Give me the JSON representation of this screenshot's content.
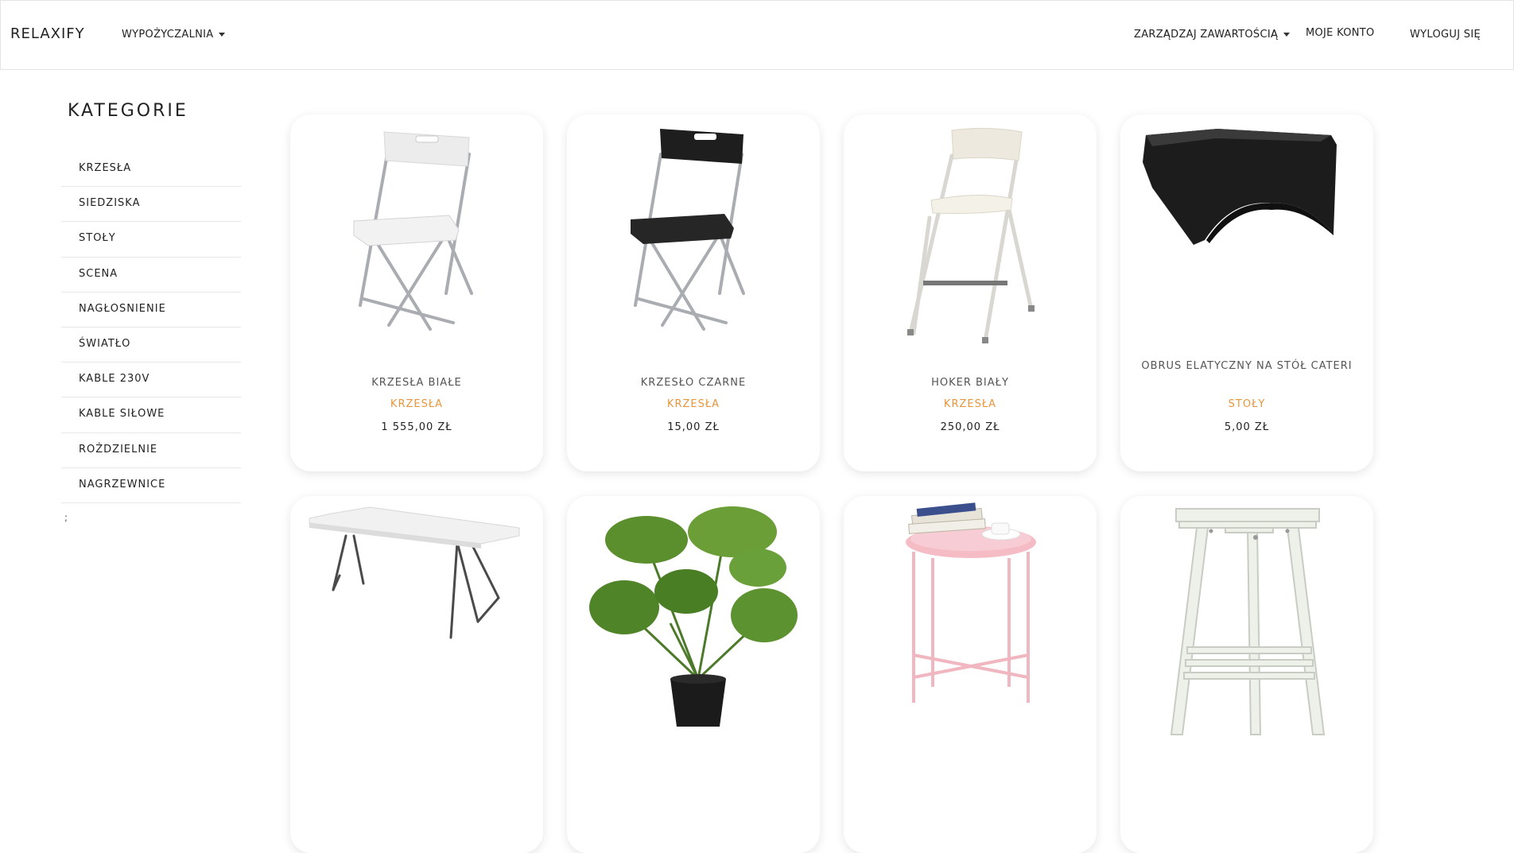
{
  "navbar": {
    "brand": "RELAXIFY",
    "rental_label": "WYPOŻYCZALNIA",
    "manage_label": "ZARZĄDZAJ ZAWARTOŚCIĄ",
    "account_label": "MOJE KONTO",
    "logout_label": "WYLOGUJ SIĘ"
  },
  "sidebar": {
    "title": "KATEGORIE",
    "categories": [
      {
        "label": "KRZESŁA"
      },
      {
        "label": "SIEDZISKA"
      },
      {
        "label": "STOŁY"
      },
      {
        "label": "SCENA"
      },
      {
        "label": "NAGŁOSNIENIE"
      },
      {
        "label": "ŚWIATŁO"
      },
      {
        "label": "KABLE 230V"
      },
      {
        "label": "KABLE SIŁOWE"
      },
      {
        "label": "ROŻDZIELNIE"
      },
      {
        "label": "NAGRZEWNICE"
      }
    ],
    "extra": ";"
  },
  "products": [
    {
      "name": "KRZESŁA BIAŁE",
      "category": "KRZESŁA",
      "price": "1 555,00 ZŁ",
      "image": "white-folding-chair"
    },
    {
      "name": "KRZESŁO CZARNE",
      "category": "KRZESŁA",
      "price": "15,00 ZŁ",
      "image": "black-folding-chair"
    },
    {
      "name": "HOKER BIAŁY",
      "category": "KRZESŁA",
      "price": "250,00 ZŁ",
      "image": "white-bar-stool"
    },
    {
      "name": "OBRUS ELATYCZNY NA STÓŁ CATERI",
      "category": "STOŁY",
      "price": "5,00 ZŁ",
      "image": "black-stretch-tablecloth"
    },
    {
      "image": "white-folding-table"
    },
    {
      "image": "potted-monstera-plant"
    },
    {
      "image": "pink-side-table"
    },
    {
      "image": "white-trestle"
    }
  ],
  "colors": {
    "category_accent": "#e8963d",
    "text": "#222222",
    "muted_text": "#555555",
    "divider": "#e7e7e7"
  }
}
